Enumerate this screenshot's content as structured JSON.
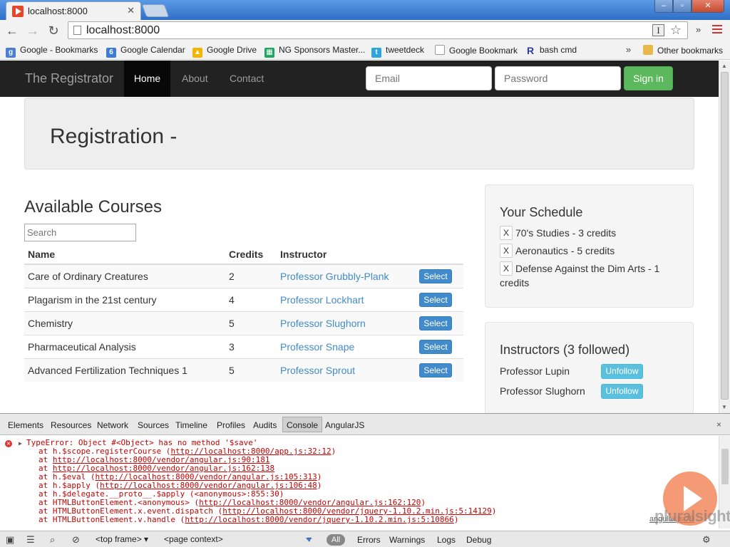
{
  "browser": {
    "tab_title": "localhost:8000",
    "tab_close": "✕",
    "url": "localhost:8000",
    "back_icon": "←",
    "forward_icon": "→",
    "reload_icon": "↻",
    "reader_icon": "I",
    "star_icon": "☆",
    "extensions_chevron": "»",
    "bookmarks": [
      {
        "label": "Google - Bookmarks",
        "icon": "google-icon",
        "color": "#4a7fd8"
      },
      {
        "label": "Google Calendar",
        "icon": "calendar-icon",
        "color": "#3d7bd8"
      },
      {
        "label": "Google Drive",
        "icon": "drive-icon",
        "color": "#f4b400"
      },
      {
        "label": "NG Sponsors Master...",
        "icon": "sheets-icon",
        "color": "#20a464"
      },
      {
        "label": "tweetdeck",
        "icon": "twitter-icon",
        "color": "#2ca4e0"
      },
      {
        "label": "Google Bookmark",
        "icon": "page-icon",
        "color": "#ffffff"
      },
      {
        "label": "bash cmd",
        "icon": "r-icon",
        "color": "#2a3d9e"
      }
    ],
    "bookmarks_chevron": "»",
    "other_bookmarks": "Other bookmarks"
  },
  "site": {
    "brand": "The Registrator",
    "nav": {
      "home": "Home",
      "about": "About",
      "contact": "Contact"
    },
    "email_placeholder": "Email",
    "password_placeholder": "Password",
    "signin": "Sign in",
    "page_title": "Registration -",
    "courses_heading": "Available Courses",
    "search_placeholder": "Search",
    "table": {
      "headers": [
        "Name",
        "Credits",
        "Instructor",
        ""
      ],
      "rows": [
        {
          "name": "Care of Ordinary Creatures",
          "credits": "2",
          "instructor": "Professor Grubbly-Plank",
          "action": "Select"
        },
        {
          "name": "Plagarism in the 21st century",
          "credits": "4",
          "instructor": "Professor Lockhart",
          "action": "Select"
        },
        {
          "name": "Chemistry",
          "credits": "5",
          "instructor": "Professor Slughorn",
          "action": "Select"
        },
        {
          "name": "Pharmaceutical Analysis",
          "credits": "3",
          "instructor": "Professor Snape",
          "action": "Select"
        },
        {
          "name": "Advanced Fertilization Techniques 1",
          "credits": "5",
          "instructor": "Professor Sprout",
          "action": "Select"
        }
      ]
    },
    "schedule": {
      "heading": "Your Schedule",
      "remove_label": "X",
      "items": [
        "70's Studies - 3 credits",
        "Aeronautics - 5 credits",
        "Defense Against the Dim Arts - 1 credits"
      ]
    },
    "instructors": {
      "heading": "Instructors (3 followed)",
      "items": [
        {
          "name": "Professor Lupin",
          "action": "Unfollow"
        },
        {
          "name": "Professor Slughorn",
          "action": "Unfollow"
        }
      ]
    }
  },
  "devtools": {
    "tabs": [
      "Elements",
      "Resources",
      "Network",
      "Sources",
      "Timeline",
      "Profiles",
      "Audits",
      "Console",
      "AngularJS"
    ],
    "active_tab": "Console",
    "close": "×",
    "error_message": "TypeError: Object #<Object> has no method '$save'",
    "trace": [
      {
        "prefix": "at h.$scope.registerCourse (",
        "link": "http://localhost:8000/app.js:32:12",
        "suffix": ")"
      },
      {
        "prefix": "at ",
        "link": "http://localhost:8000/vendor/angular.js:90:181",
        "suffix": ""
      },
      {
        "prefix": "at ",
        "link": "http://localhost:8000/vendor/angular.js:162:138",
        "suffix": ""
      },
      {
        "prefix": "at h.$eval (",
        "link": "http://localhost:8000/vendor/angular.js:105:313",
        "suffix": ")"
      },
      {
        "prefix": "at h.$apply (",
        "link": "http://localhost:8000/vendor/angular.js:106:48",
        "suffix": ")"
      },
      {
        "prefix": "at h.$delegate.__proto__.$apply (<anonymous>:855:30)",
        "link": "",
        "suffix": ""
      },
      {
        "prefix": "at HTMLButtonElement.<anonymous> (",
        "link": "http://localhost:8000/vendor/angular.js:162:120",
        "suffix": ")"
      },
      {
        "prefix": "at HTMLButtonElement.x.event.dispatch (",
        "link": "http://localhost:8000/vendor/jquery-1.10.2.min.js:5:14129",
        "suffix": ")"
      },
      {
        "prefix": "at HTMLButtonElement.v.handle (",
        "link": "http://localhost:8000/vendor/jquery-1.10.2.min.js:5:10866",
        "suffix": ")"
      }
    ],
    "source_link": "angular.js:79",
    "frame_select": "<top frame>",
    "context_select": "<page context>",
    "filters": {
      "all": "All",
      "errors": "Errors",
      "warnings": "Warnings",
      "logs": "Logs",
      "debug": "Debug"
    }
  },
  "watermark": "pluralsight",
  "colors": {
    "navbar": "#222222",
    "primary": "#428bca",
    "success": "#5cb85c",
    "info": "#5bc0de",
    "error": "#cc0000"
  }
}
